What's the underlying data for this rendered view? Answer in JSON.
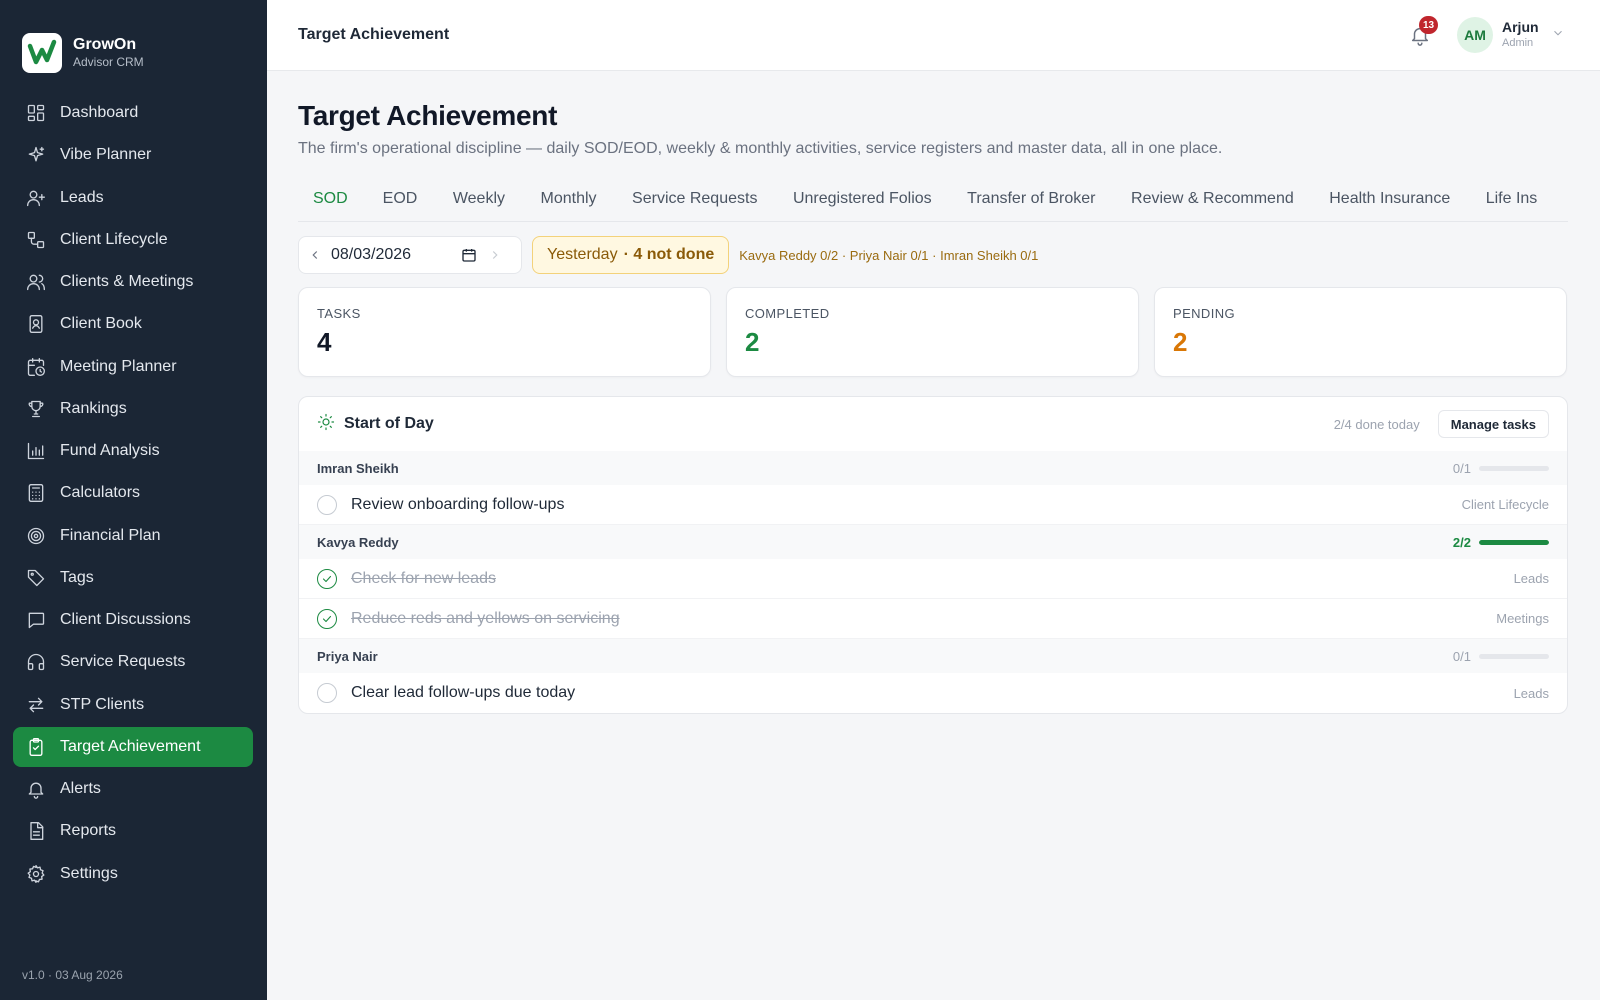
{
  "brand": {
    "name": "GrowOn",
    "subtitle": "Advisor CRM",
    "logo_icon": "growth-w-icon",
    "accent": "#1c8a42"
  },
  "sidebar": {
    "items": [
      {
        "label": "Dashboard",
        "icon": "grid-icon"
      },
      {
        "label": "Vibe Planner",
        "icon": "sparkle-icon"
      },
      {
        "label": "Leads",
        "icon": "user-plus-icon"
      },
      {
        "label": "Client Lifecycle",
        "icon": "lifecycle-icon"
      },
      {
        "label": "Clients & Meetings",
        "icon": "users-icon"
      },
      {
        "label": "Client Book",
        "icon": "book-icon"
      },
      {
        "label": "Meeting Planner",
        "icon": "calendar-clock-icon"
      },
      {
        "label": "Rankings",
        "icon": "trophy-icon"
      },
      {
        "label": "Fund Analysis",
        "icon": "bar-chart-icon"
      },
      {
        "label": "Calculators",
        "icon": "calculator-icon"
      },
      {
        "label": "Financial Plan",
        "icon": "target-icon"
      },
      {
        "label": "Tags",
        "icon": "tag-icon"
      },
      {
        "label": "Client Discussions",
        "icon": "message-icon"
      },
      {
        "label": "Service Requests",
        "icon": "headset-icon"
      },
      {
        "label": "STP Clients",
        "icon": "arrows-icon"
      },
      {
        "label": "Target Achievement",
        "icon": "clipboard-check-icon",
        "active": true
      },
      {
        "label": "Alerts",
        "icon": "bell-icon"
      },
      {
        "label": "Reports",
        "icon": "file-text-icon"
      },
      {
        "label": "Settings",
        "icon": "gear-icon"
      }
    ],
    "version": "v1.0 · 03 Aug 2026"
  },
  "header": {
    "title": "Target Achievement",
    "notifications_count": "13",
    "user": {
      "initials": "AM",
      "name": "Arjun",
      "role": "Admin"
    }
  },
  "main": {
    "title": "Target Achievement",
    "description": "The firm's operational discipline — daily SOD/EOD, weekly & monthly activities, service registers and master data, all in one place.",
    "tabs": [
      "SOD",
      "EOD",
      "Weekly",
      "Monthly",
      "Service Requests",
      "Unregistered Folios",
      "Transfer of Broker",
      "Review & Recommend",
      "Health Insurance",
      "Life Ins"
    ],
    "active_tab": "SOD",
    "date": "08/03/2026",
    "yesterday": {
      "label": "Yesterday",
      "status": "· 4 not done",
      "detail": "Kavya Reddy 0/2 · Priya Nair 0/1 · Imran Sheikh 0/1"
    },
    "stats": [
      {
        "label": "TASKS",
        "value": "4",
        "color": "#111827"
      },
      {
        "label": "COMPLETED",
        "value": "2",
        "color": "#1c8a42"
      },
      {
        "label": "PENDING",
        "value": "2",
        "color": "#d97706"
      }
    ],
    "sod": {
      "title": "Start of Day",
      "done_summary": "2/4 done today",
      "manage_label": "Manage tasks",
      "groups": [
        {
          "name": "Imran Sheikh",
          "score": "0/1",
          "progress": 0,
          "tasks": [
            {
              "label": "Review onboarding follow-ups",
              "tag": "Client Lifecycle",
              "done": false
            }
          ]
        },
        {
          "name": "Kavya Reddy",
          "score": "2/2",
          "progress": 1,
          "tasks": [
            {
              "label": "Check for new leads",
              "tag": "Leads",
              "done": true
            },
            {
              "label": "Reduce reds and yellows on servicing",
              "tag": "Meetings",
              "done": true
            }
          ]
        },
        {
          "name": "Priya Nair",
          "score": "0/1",
          "progress": 0,
          "tasks": [
            {
              "label": "Clear lead follow-ups due today",
              "tag": "Leads",
              "done": false
            }
          ]
        }
      ]
    }
  }
}
